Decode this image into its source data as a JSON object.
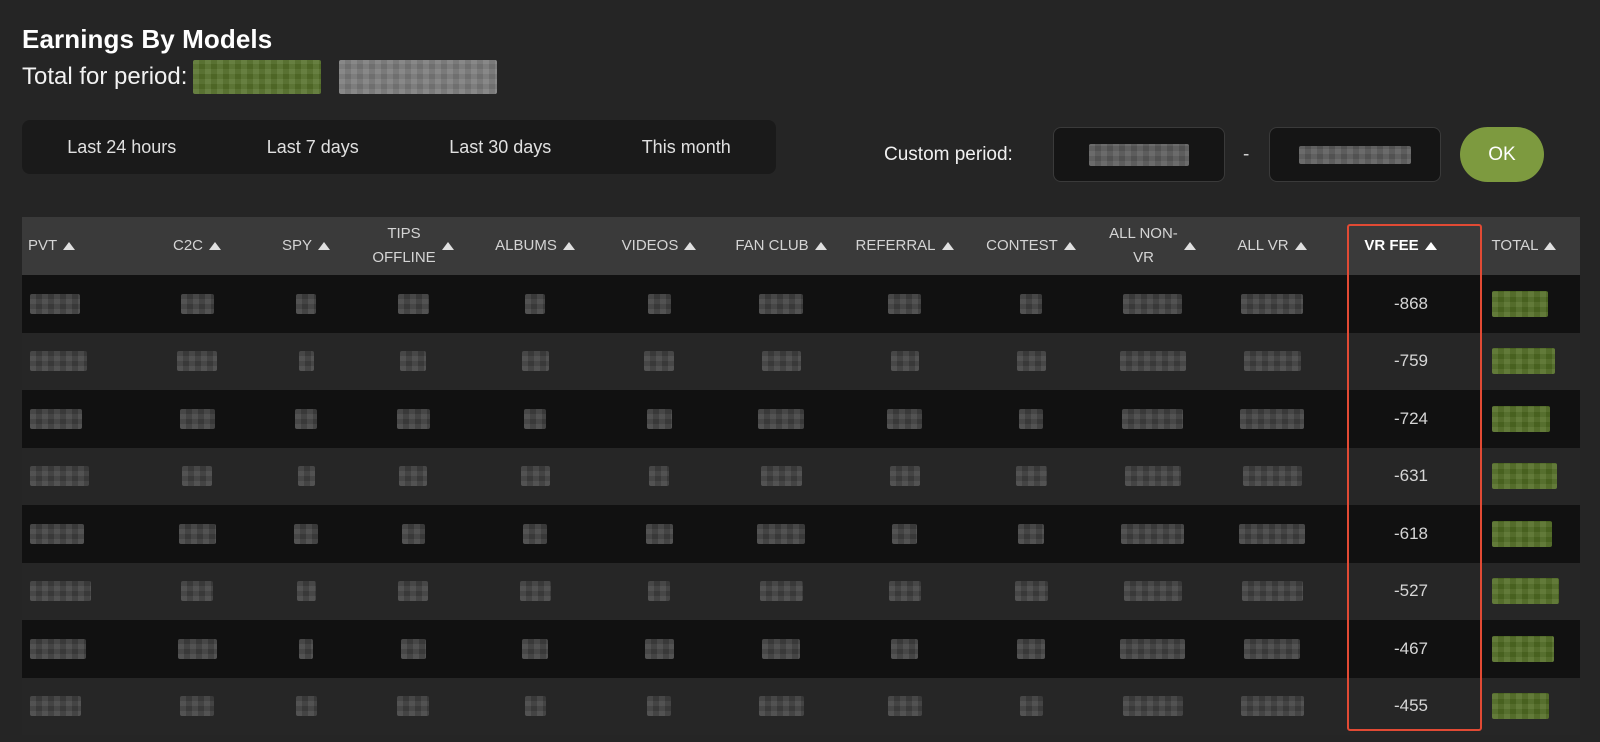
{
  "page": {
    "title": "Earnings By Models",
    "total_label": "Total for period:"
  },
  "periods": [
    "Last 24 hours",
    "Last 7 days",
    "Last 30 days",
    "This month"
  ],
  "custom_period": {
    "label": "Custom period:",
    "separator": "-",
    "ok_label": "OK"
  },
  "columns": [
    {
      "label": "PVT"
    },
    {
      "label": "C2C"
    },
    {
      "label": "SPY"
    },
    {
      "label": "TIPS\nOFFLINE"
    },
    {
      "label": "ALBUMS"
    },
    {
      "label": "VIDEOS"
    },
    {
      "label": "FAN CLUB"
    },
    {
      "label": "REFERRAL"
    },
    {
      "label": "CONTEST"
    },
    {
      "label": "ALL NON-\nVR"
    },
    {
      "label": "ALL VR"
    },
    {
      "label": "VR FEE"
    },
    {
      "label": "TOTAL"
    }
  ],
  "rows": [
    {
      "vr_fee": "-868"
    },
    {
      "vr_fee": "-759"
    },
    {
      "vr_fee": "-724"
    },
    {
      "vr_fee": "-631"
    },
    {
      "vr_fee": "-618"
    },
    {
      "vr_fee": "-527"
    },
    {
      "vr_fee": "-467"
    },
    {
      "vr_fee": "-455"
    }
  ],
  "colors": {
    "background": "#252525",
    "ok_button": "#7d9a3f",
    "highlight": "#e24a34",
    "row_dark": "#111111",
    "row_light": "#262626",
    "header_bg": "#3a3a3a"
  },
  "icons": {
    "sort": "sort-ascending-icon"
  }
}
